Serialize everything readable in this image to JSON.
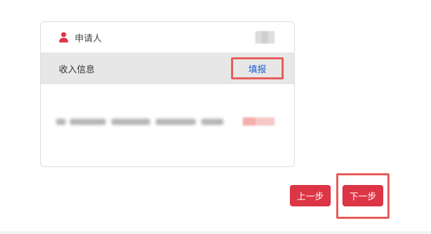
{
  "card": {
    "applicant_label": "申请人",
    "section_title": "收入信息",
    "fill_button_label": "填报"
  },
  "footer": {
    "prev_label": "上一步",
    "next_label": "下一步"
  },
  "colors": {
    "accent_red": "#dc3545",
    "highlight_red": "#e85b5b",
    "link_blue": "#1a5bd6",
    "section_bg": "#e7e7e7"
  },
  "icons": {
    "applicant": "person-icon"
  }
}
